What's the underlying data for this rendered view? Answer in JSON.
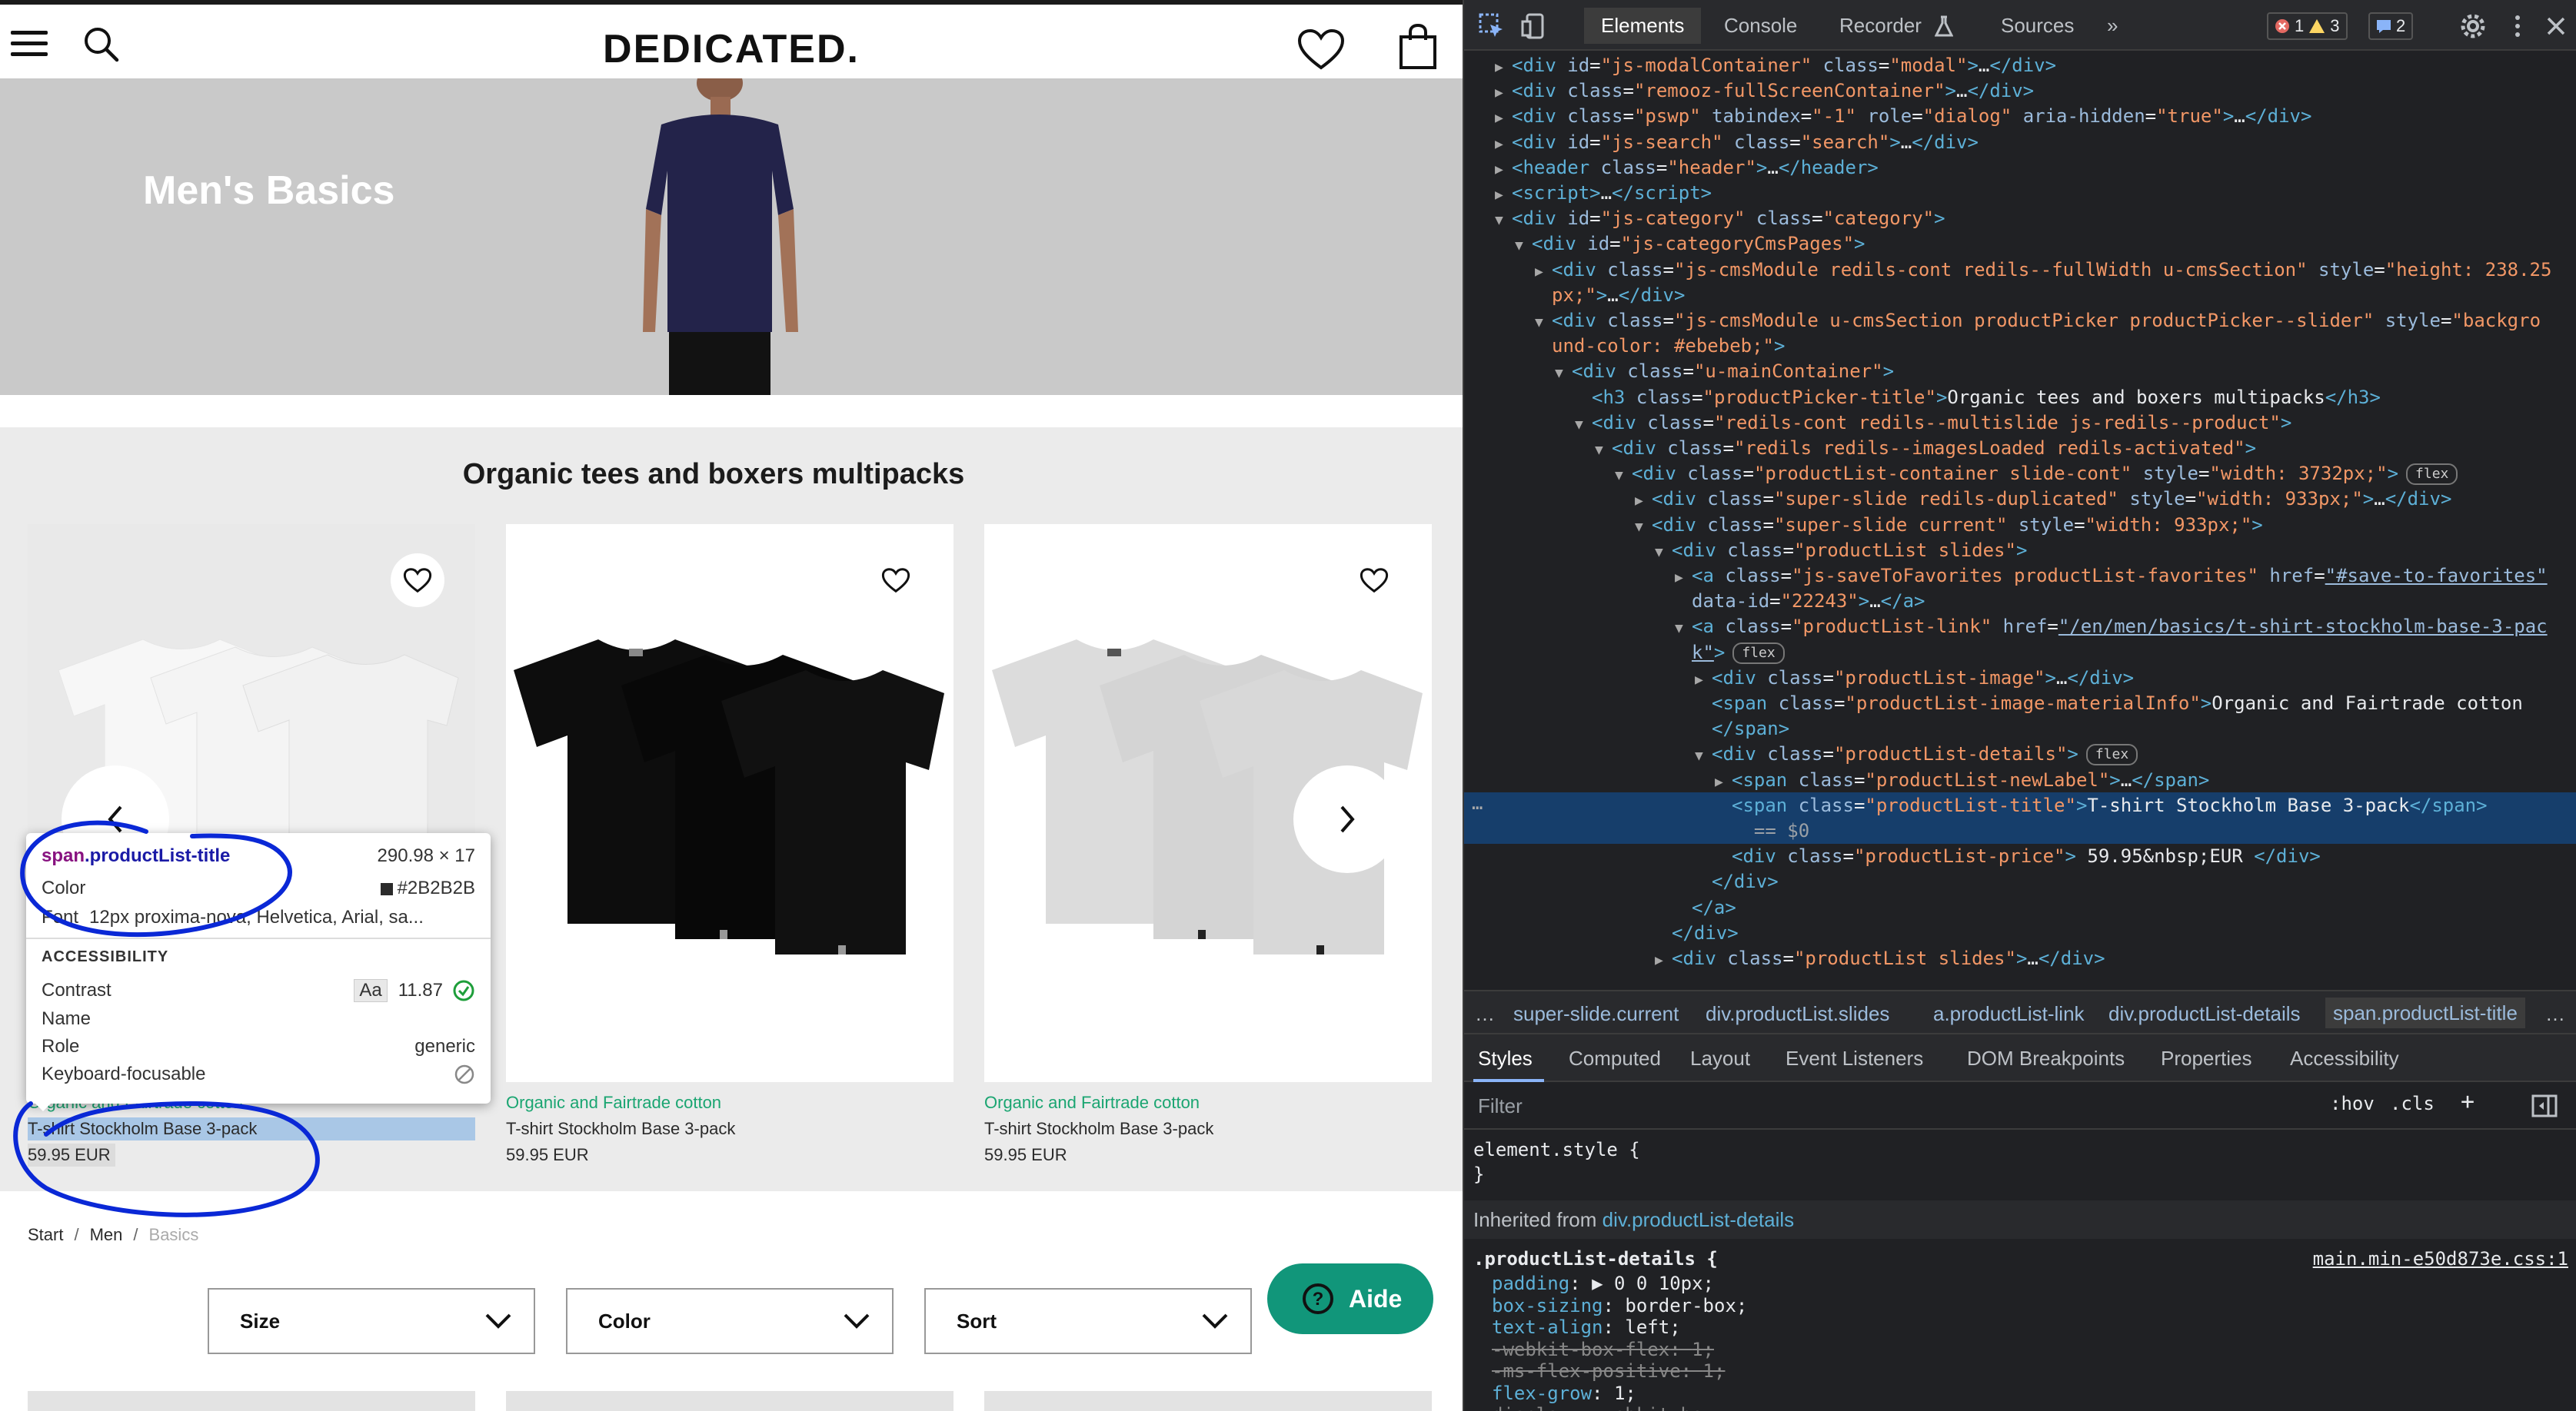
{
  "site": {
    "logo": "DEDICATED.",
    "hero_title": "Men's Basics",
    "picker_title": "Organic tees and boxers multipacks",
    "products": [
      {
        "material": "Organic and Fairtrade cotton",
        "title": "T-shirt Stockholm Base 3-pack",
        "price": "59.95 EUR"
      },
      {
        "material": "Organic and Fairtrade cotton",
        "title": "T-shirt Stockholm Base 3-pack",
        "price": "59.95 EUR"
      },
      {
        "material": "Organic and Fairtrade cotton",
        "title": "T-shirt Stockholm Base 3-pack",
        "price": "59.95 EUR"
      }
    ],
    "breadcrumb": [
      "Start",
      "Men",
      "Basics"
    ],
    "filters": [
      "Size",
      "Color",
      "Sort"
    ],
    "help_label": "Aide",
    "colors": {
      "hero_bg": "#c9c9c9",
      "picker_bg": "#ebebeb",
      "material_green": "#1aa571",
      "help_bg": "#11967a",
      "annotation_blue": "#0a28d6"
    },
    "tee_colors": [
      "#f4f4f4",
      "#0b0b0b",
      "#d9d9d9"
    ]
  },
  "tooltip": {
    "selector_tag": "span",
    "selector_class": ".productList-title",
    "size": "290.98 × 17",
    "color_label": "Color",
    "color_value": "#2B2B2B",
    "font_label": "Font",
    "font_value": "12px proxima-nova, Helvetica, Arial, sa...",
    "section": "ACCESSIBILITY",
    "contrast_label": "Contrast",
    "contrast_aa": "Aa",
    "contrast_value": "11.87",
    "name_label": "Name",
    "role_label": "Role",
    "role_value": "generic",
    "keyboard_label": "Keyboard-focusable"
  },
  "devtools": {
    "tabs": [
      "Elements",
      "Console",
      "Recorder",
      "Sources"
    ],
    "more": "»",
    "errors": "1",
    "warnings": "3",
    "messages": "2",
    "dom_lines": [
      {
        "indent": 1,
        "tri": "▶",
        "html": "<span class='tg'>&lt;div</span> <span class='an'>id</span>=<span class='av'>\"js-modalContainer\"</span> <span class='an'>class</span>=<span class='av'>\"modal\"</span><span class='tg'>&gt;</span>…<span class='tg'>&lt;/div&gt;</span>"
      },
      {
        "indent": 1,
        "tri": "▶",
        "html": "<span class='tg'>&lt;div</span> <span class='an'>class</span>=<span class='av'>\"remooz-fullScreenContainer\"</span><span class='tg'>&gt;</span>…<span class='tg'>&lt;/div&gt;</span>"
      },
      {
        "indent": 1,
        "tri": "▶",
        "html": "<span class='tg'>&lt;div</span> <span class='an'>class</span>=<span class='av'>\"pswp\"</span> <span class='an'>tabindex</span>=<span class='av'>\"-1\"</span> <span class='an'>role</span>=<span class='av'>\"dialog\"</span> <span class='an'>aria-hidden</span>=<span class='av'>\"true\"</span><span class='tg'>&gt;</span>…<span class='tg'>&lt;/div&gt;</span>"
      },
      {
        "indent": 1,
        "tri": "▶",
        "html": "<span class='tg'>&lt;div</span> <span class='an'>id</span>=<span class='av'>\"js-search\"</span> <span class='an'>class</span>=<span class='av'>\"search\"</span><span class='tg'>&gt;</span>…<span class='tg'>&lt;/div&gt;</span>"
      },
      {
        "indent": 1,
        "tri": "▶",
        "html": "<span class='tg'>&lt;header</span> <span class='an'>class</span>=<span class='av'>\"header\"</span><span class='tg'>&gt;</span>…<span class='tg'>&lt;/header&gt;</span>"
      },
      {
        "indent": 1,
        "tri": "▶",
        "html": "<span class='tg'>&lt;script&gt;</span>…<span class='tg'>&lt;/script&gt;</span>"
      },
      {
        "indent": 1,
        "tri": "▼",
        "html": "<span class='tg'>&lt;div</span> <span class='an'>id</span>=<span class='av'>\"js-category\"</span> <span class='an'>class</span>=<span class='av'>\"category\"</span><span class='tg'>&gt;</span>"
      },
      {
        "indent": 2,
        "tri": "▼",
        "html": "<span class='tg'>&lt;div</span> <span class='an'>id</span>=<span class='av'>\"js-categoryCmsPages\"</span><span class='tg'>&gt;</span>"
      },
      {
        "indent": 3,
        "tri": "▶",
        "html": "<span class='tg'>&lt;div</span> <span class='an'>class</span>=<span class='av'>\"js-cmsModule redils-cont redils--fullWidth u-cmsSection\"</span> <span class='an'>style</span>=<span class='av'>\"height: 238.25</span>"
      },
      {
        "indent": 3,
        "tri": "",
        "html": "<span class='av'>px;\"</span><span class='tg'>&gt;</span>…<span class='tg'>&lt;/div&gt;</span>"
      },
      {
        "indent": 3,
        "tri": "▼",
        "html": "<span class='tg'>&lt;div</span> <span class='an'>class</span>=<span class='av'>\"js-cmsModule u-cmsSection productPicker productPicker--slider\"</span> <span class='an'>style</span>=<span class='av'>\"backgro</span>"
      },
      {
        "indent": 3,
        "tri": "",
        "html": "<span class='av'>und-color: #ebebeb;\"</span><span class='tg'>&gt;</span>"
      },
      {
        "indent": 4,
        "tri": "▼",
        "html": "<span class='tg'>&lt;div</span> <span class='an'>class</span>=<span class='av'>\"u-mainContainer\"</span><span class='tg'>&gt;</span>"
      },
      {
        "indent": 5,
        "tri": "",
        "html": "<span class='tg'>&lt;h3</span> <span class='an'>class</span>=<span class='av'>\"productPicker-title\"</span><span class='tg'>&gt;</span>Organic tees and boxers multipacks<span class='tg'>&lt;/h3&gt;</span>"
      },
      {
        "indent": 5,
        "tri": "▼",
        "html": "<span class='tg'>&lt;div</span> <span class='an'>class</span>=<span class='av'>\"redils-cont redils--multislide js-redils--product\"</span><span class='tg'>&gt;</span>"
      },
      {
        "indent": 6,
        "tri": "▼",
        "html": "<span class='tg'>&lt;div</span> <span class='an'>class</span>=<span class='av'>\"redils redils--imagesLoaded redils-activated\"</span><span class='tg'>&gt;</span>"
      },
      {
        "indent": 7,
        "tri": "▼",
        "html": "<span class='tg'>&lt;div</span> <span class='an'>class</span>=<span class='av'>\"productList-container slide-cont\"</span> <span class='an'>style</span>=<span class='av'>\"width: 3732px;\"</span><span class='tg'>&gt;</span><span class='pill'>flex</span>"
      },
      {
        "indent": 8,
        "tri": "▶",
        "html": "<span class='tg'>&lt;div</span> <span class='an'>class</span>=<span class='av'>\"super-slide redils-duplicated\"</span> <span class='an'>style</span>=<span class='av'>\"width: 933px;\"</span><span class='tg'>&gt;</span>…<span class='tg'>&lt;/div&gt;</span>"
      },
      {
        "indent": 8,
        "tri": "▼",
        "html": "<span class='tg'>&lt;div</span> <span class='an'>class</span>=<span class='av'>\"super-slide current\"</span> <span class='an'>style</span>=<span class='av'>\"width: 933px;\"</span><span class='tg'>&gt;</span>"
      },
      {
        "indent": 9,
        "tri": "▼",
        "html": "<span class='tg'>&lt;div</span> <span class='an'>class</span>=<span class='av'>\"productList slides\"</span><span class='tg'>&gt;</span>"
      },
      {
        "indent": 10,
        "tri": "▶",
        "html": "<span class='tg'>&lt;a</span> <span class='an'>class</span>=<span class='av'>\"js-saveToFavorites productList-favorites\"</span> <span class='an'>href</span>=<span class='lk'>\"#save-to-favorites\"</span>"
      },
      {
        "indent": 10,
        "tri": "",
        "html": "<span class='an'>data-id</span>=<span class='av'>\"22243\"</span><span class='tg'>&gt;</span>…<span class='tg'>&lt;/a&gt;</span>"
      },
      {
        "indent": 10,
        "tri": "▼",
        "html": "<span class='tg'>&lt;a</span> <span class='an'>class</span>=<span class='av'>\"productList-link\"</span> <span class='an'>href</span>=<span class='lk'>\"/en/men/basics/t-shirt-stockholm-base-3-pac</span>"
      },
      {
        "indent": 10,
        "tri": "",
        "html": "<span class='lk'>k\"</span><span class='tg'>&gt;</span><span class='pill'>flex</span>"
      },
      {
        "indent": 11,
        "tri": "▶",
        "html": "<span class='tg'>&lt;div</span> <span class='an'>class</span>=<span class='av'>\"productList-image\"</span><span class='tg'>&gt;</span>…<span class='tg'>&lt;/div&gt;</span>"
      },
      {
        "indent": 11,
        "tri": "",
        "html": "<span class='tg'>&lt;span</span> <span class='an'>class</span>=<span class='av'>\"productList-image-materialInfo\"</span><span class='tg'>&gt;</span>Organic and Fairtrade cotton"
      },
      {
        "indent": 11,
        "tri": "",
        "html": "<span class='tg'>&lt;/span&gt;</span>"
      },
      {
        "indent": 11,
        "tri": "▼",
        "html": "<span class='tg'>&lt;div</span> <span class='an'>class</span>=<span class='av'>\"productList-details\"</span><span class='tg'>&gt;</span><span class='pill'>flex</span>"
      },
      {
        "indent": 12,
        "tri": "▶",
        "html": "<span class='tg'>&lt;span</span> <span class='an'>class</span>=<span class='av'>\"productList-newLabel\"</span><span class='tg'>&gt;</span>…<span class='tg'>&lt;/span&gt;</span>"
      },
      {
        "indent": 12,
        "tri": "",
        "sel": true,
        "html": "<span class='tg'>&lt;span</span> <span class='an'>class</span>=<span class='av'>\"productList-title\"</span><span class='tg'>&gt;</span>T-shirt Stockholm Base 3-pack<span class='tg'>&lt;/span&gt;</span>"
      },
      {
        "indent": 12,
        "tri": "",
        "sel": true,
        "html": "&nbsp;&nbsp;<span style='color:#9aa0a6'>== $0</span>"
      },
      {
        "indent": 12,
        "tri": "",
        "html": "<span class='tg'>&lt;div</span> <span class='an'>class</span>=<span class='av'>\"productList-price\"</span><span class='tg'>&gt;</span> 59.95&amp;nbsp;EUR <span class='tg'>&lt;/div&gt;</span>"
      },
      {
        "indent": 11,
        "tri": "",
        "html": "<span class='tg'>&lt;/div&gt;</span>"
      },
      {
        "indent": 10,
        "tri": "",
        "html": "<span class='tg'>&lt;/a&gt;</span>"
      },
      {
        "indent": 9,
        "tri": "",
        "html": "<span class='tg'>&lt;/div&gt;</span>"
      },
      {
        "indent": 9,
        "tri": "▶",
        "html": "<span class='tg'>&lt;div</span> <span class='an'>class</span>=<span class='av'>\"productList slides\"</span><span class='tg'>&gt;</span>…<span class='tg'>&lt;/div&gt;</span>"
      }
    ],
    "crumbs": [
      "super-slide.current",
      "div.productList.slides",
      "a.productList-link",
      "div.productList-details",
      "span.productList-title"
    ],
    "subtabs": [
      "Styles",
      "Computed",
      "Layout",
      "Event Listeners",
      "DOM Breakpoints",
      "Properties",
      "Accessibility"
    ],
    "filter_placeholder": "Filter",
    "hov": ":hov",
    "cls": ".cls",
    "plus": "+",
    "element_style": "element.style {",
    "close_brace": "}",
    "inherited_label": "Inherited from",
    "inherited_from": "div.productList-details",
    "rule_selector": ".productList-details {",
    "rule_source": "main.min-e50d873e.css:1",
    "rule_props": [
      {
        "name": "padding",
        "value": "▶ 0 0 10px;",
        "strike": false
      },
      {
        "name": "box-sizing",
        "value": "border-box;",
        "strike": false
      },
      {
        "name": "text-align",
        "value": "left;",
        "strike": false
      },
      {
        "name": "-webkit-box-flex",
        "value": "1;",
        "strike": true
      },
      {
        "name": "-ms-flex-positive",
        "value": "1;",
        "strike": true
      },
      {
        "name": "flex-grow",
        "value": "1;",
        "strike": false
      },
      {
        "name": "display",
        "value": "-webkit-box;",
        "strike": true
      }
    ]
  }
}
